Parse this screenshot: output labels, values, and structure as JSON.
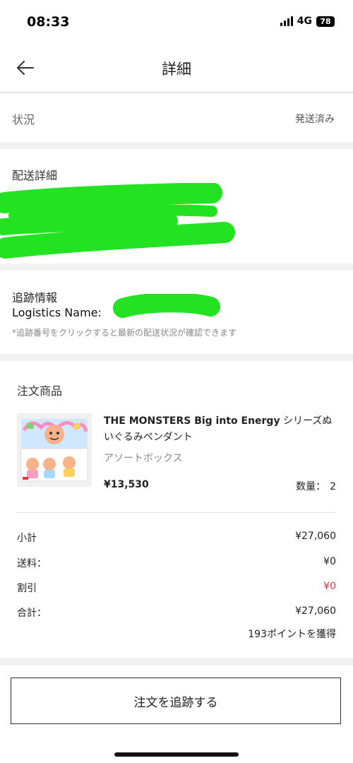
{
  "status_bar": {
    "time": "08:33",
    "network": "4G",
    "battery": "78",
    "icons": [
      "signal-icon",
      "battery-icon"
    ]
  },
  "header": {
    "title": "詳細",
    "back_icon": "arrow-left-icon"
  },
  "status_section": {
    "label": "状況",
    "value": "発送済み"
  },
  "delivery_section": {
    "title": "配送詳細",
    "redaction_color": "#22e222"
  },
  "tracking_section": {
    "title": "追跡情報",
    "logistics_label": "Logistics Name:",
    "note": "*追跡番号をクリックすると最新の配送状況が確認できます"
  },
  "order_section": {
    "title": "注文商品",
    "product": {
      "name_en": "THE MONSTERS Big into Energy",
      "name_jp": " シリーズぬいぐるみペンダント",
      "variant": "アソートボックス",
      "price": "¥13,530",
      "qty_label": "数量：",
      "qty_value": "2"
    },
    "summary": [
      {
        "label": "小計",
        "value": "¥27,060"
      },
      {
        "label": "送料：",
        "value": "¥0"
      },
      {
        "label": "割引",
        "value": "¥0"
      },
      {
        "label": "合計：",
        "value": "¥27,060"
      }
    ],
    "points": "193ポイントを獲得"
  },
  "bottom": {
    "track_button": "注文を追跡する"
  },
  "colors": {
    "discount_red": "#e0383e",
    "redaction_green": "#22e222"
  }
}
